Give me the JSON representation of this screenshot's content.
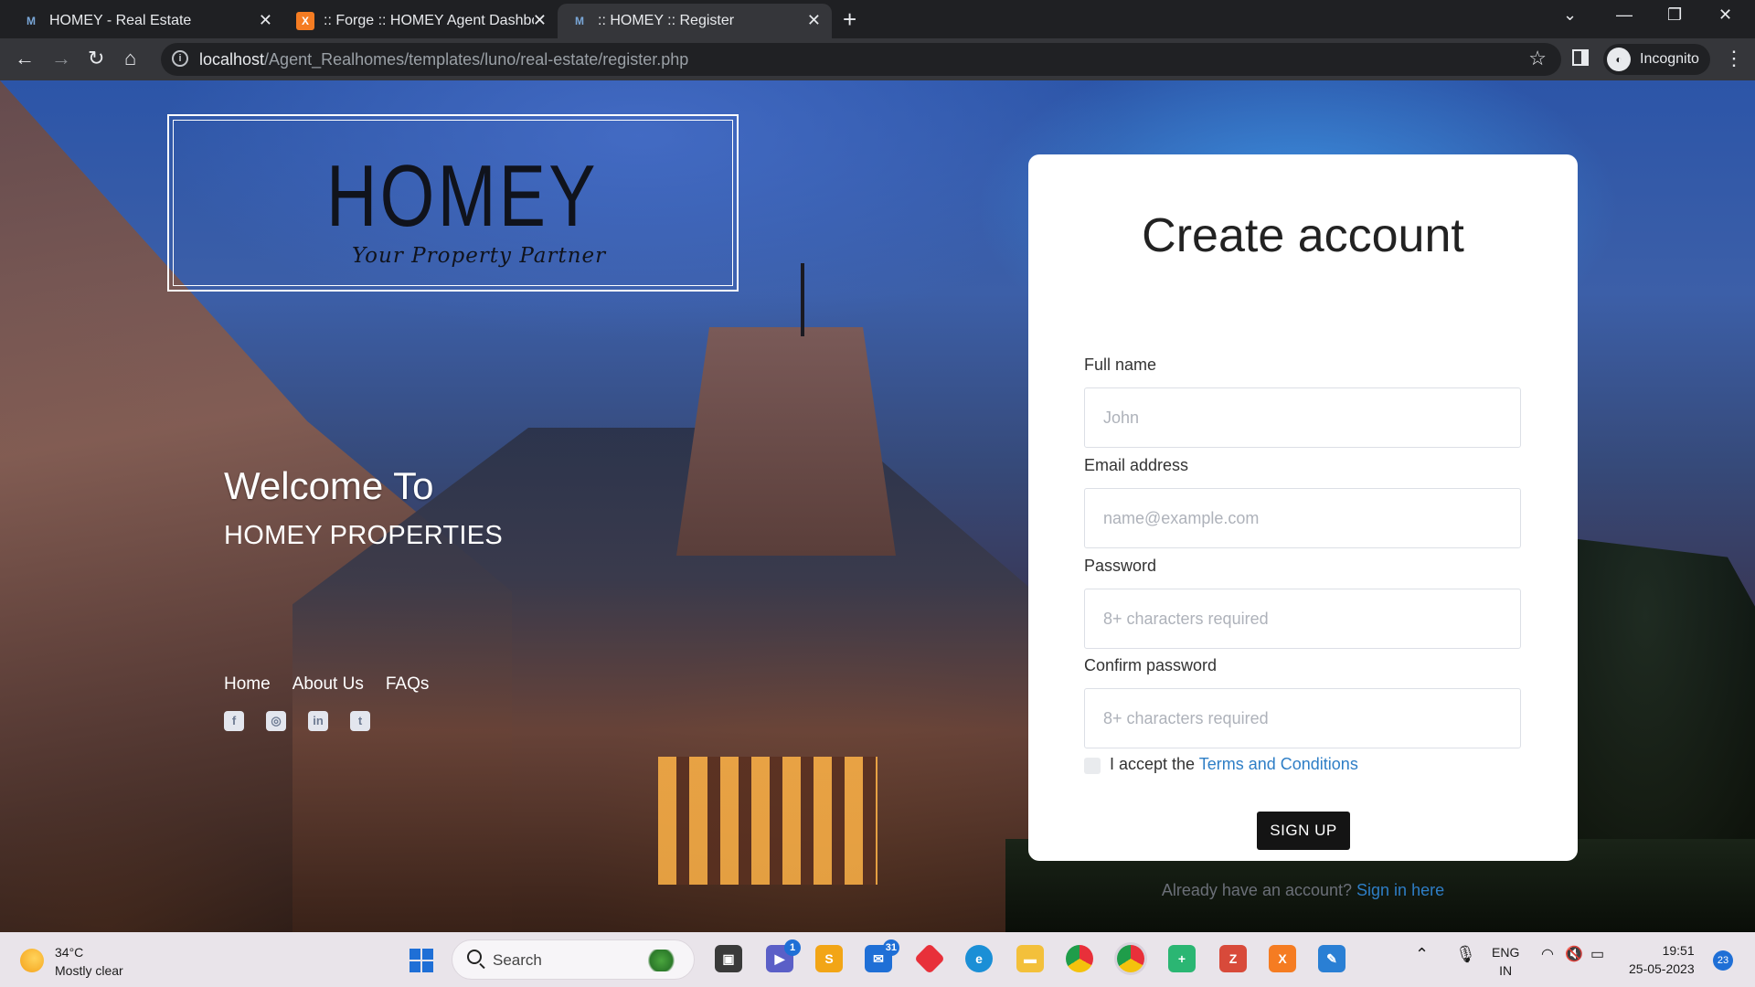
{
  "browser": {
    "tabs": [
      {
        "title": "HOMEY - Real Estate",
        "icon": "homey-favicon",
        "active": false
      },
      {
        "title": ":: Forge :: HOMEY Agent Dashboard",
        "icon": "xampp-favicon",
        "active": false
      },
      {
        "title": ":: HOMEY :: Register",
        "icon": "homey-favicon",
        "active": true
      }
    ],
    "url_host": "localhost",
    "url_path": "/Agent_Realhomes/templates/luno/real-estate/register.php",
    "profile_label": "Incognito"
  },
  "hero": {
    "logo_word": "HOMEY",
    "logo_tagline": "Your Property Partner",
    "welcome": "Welcome To",
    "brand": "HOMEY PROPERTIES",
    "nav": [
      "Home",
      "About Us",
      "FAQs"
    ],
    "socials": [
      "facebook-icon",
      "github-icon",
      "linkedin-icon",
      "twitter-icon"
    ]
  },
  "form": {
    "title": "Create account",
    "full_name": {
      "label": "Full name",
      "placeholder": "John"
    },
    "email": {
      "label": "Email address",
      "placeholder": "name@example.com"
    },
    "password": {
      "label": "Password",
      "placeholder": "8+ characters required"
    },
    "confirm": {
      "label": "Confirm password",
      "placeholder": "8+ characters required"
    },
    "terms_prefix": "I accept the ",
    "terms_link": "Terms and Conditions",
    "submit": "SIGN UP",
    "signin_prefix": "Already have an account? ",
    "signin_link": "Sign in here",
    "link_color": "#2e7ec6"
  },
  "taskbar": {
    "temperature": "34°C",
    "weather": "Mostly clear",
    "search_label": "Search",
    "badges": {
      "teams": "1",
      "mail": "31",
      "notifications": "23"
    },
    "language": "ENG",
    "region": "IN",
    "time": "19:51",
    "date": "25-05-2023"
  }
}
